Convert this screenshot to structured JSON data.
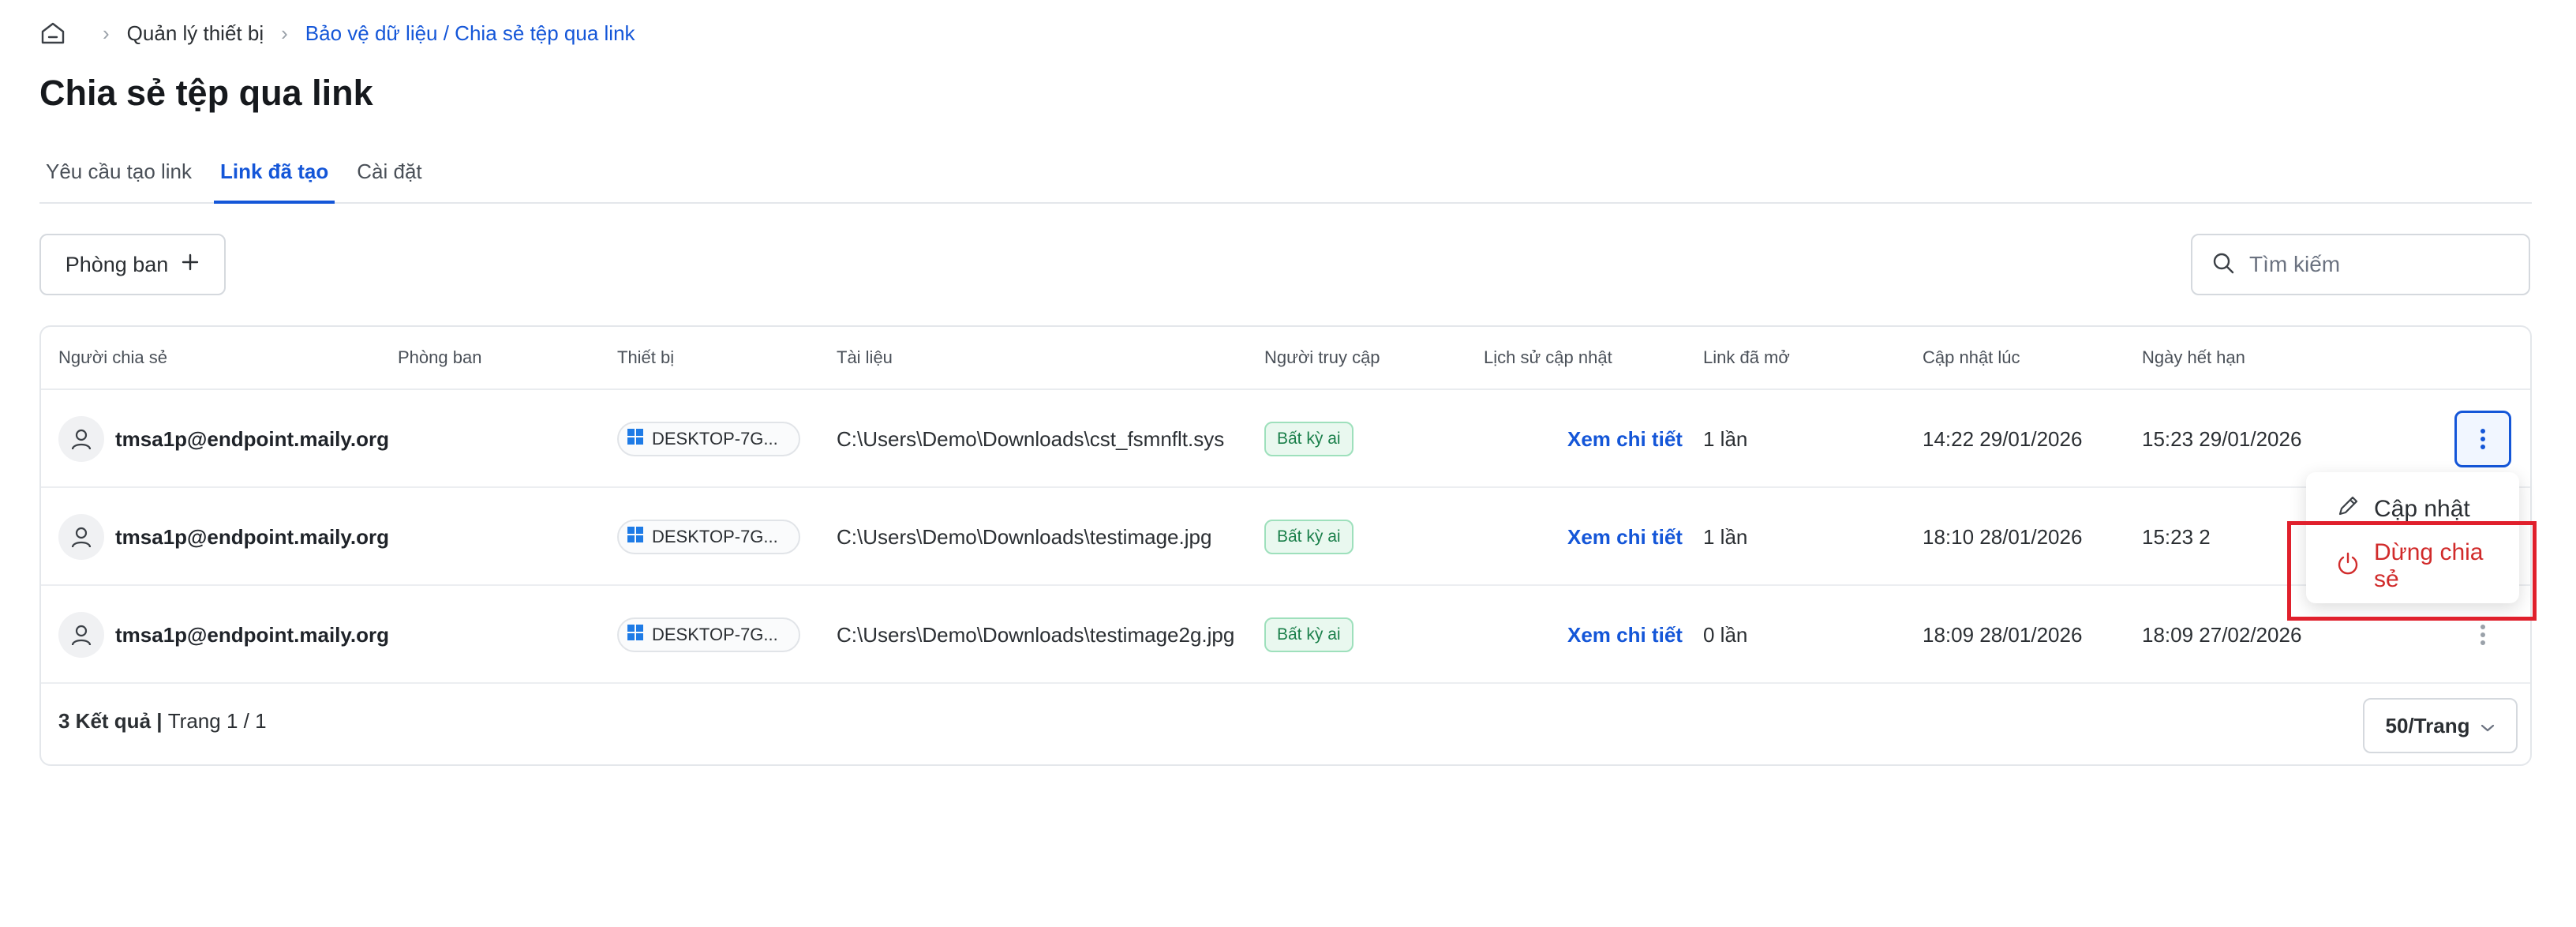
{
  "breadcrumb": {
    "item1": "Quản lý thiết bị",
    "item2": "Bảo vệ dữ liệu / Chia sẻ tệp qua link"
  },
  "page": {
    "title": "Chia sẻ tệp qua link"
  },
  "tabs": [
    {
      "label": "Yêu cầu tạo link"
    },
    {
      "label": "Link đã tạo"
    },
    {
      "label": "Cài đặt"
    }
  ],
  "toolbar": {
    "dept_label": "Phòng ban",
    "search_placeholder": "Tìm kiếm"
  },
  "table": {
    "headers": [
      "Người chia sẻ",
      "Phòng ban",
      "Thiết bị",
      "Tài liệu",
      "Người truy cập",
      "Lịch sử cập nhật",
      "Link đã mở",
      "Cập nhật lúc",
      "Ngày hết hạn"
    ],
    "rows": [
      {
        "user": "tmsa1p@endpoint.maily.org",
        "department": "",
        "device": "DESKTOP-7G...",
        "document": "C:\\Users\\Demo\\Downloads\\cst_fsmnflt.sys",
        "access": "Bất kỳ ai",
        "history": "Xem chi tiết",
        "opened": "1 lần",
        "updated": "14:22 29/01/2026",
        "expires": "15:23 29/01/2026"
      },
      {
        "user": "tmsa1p@endpoint.maily.org",
        "department": "",
        "device": "DESKTOP-7G...",
        "document": "C:\\Users\\Demo\\Downloads\\testimage.jpg",
        "access": "Bất kỳ ai",
        "history": "Xem chi tiết",
        "opened": "1 lần",
        "updated": "18:10 28/01/2026",
        "expires": "15:23 2"
      },
      {
        "user": "tmsa1p@endpoint.maily.org",
        "department": "",
        "device": "DESKTOP-7G...",
        "document": "C:\\Users\\Demo\\Downloads\\testimage2g.jpg",
        "access": "Bất kỳ ai",
        "history": "Xem chi tiết",
        "opened": "0 lần",
        "updated": "18:09 28/01/2026",
        "expires": "18:09 27/02/2026"
      }
    ]
  },
  "footer": {
    "results": "3 Kết quả",
    "separator": " | ",
    "page_info": "Trang 1 / 1",
    "page_size": "50/Trang"
  },
  "context_menu": {
    "update": "Cập nhật",
    "stop": "Dừng chia sẻ"
  },
  "colors": {
    "accent": "#1456d8",
    "danger": "#d12b2b",
    "success_bg": "#e9f8ef",
    "success_text": "#1a7f4a",
    "highlight": "#e0202c"
  }
}
